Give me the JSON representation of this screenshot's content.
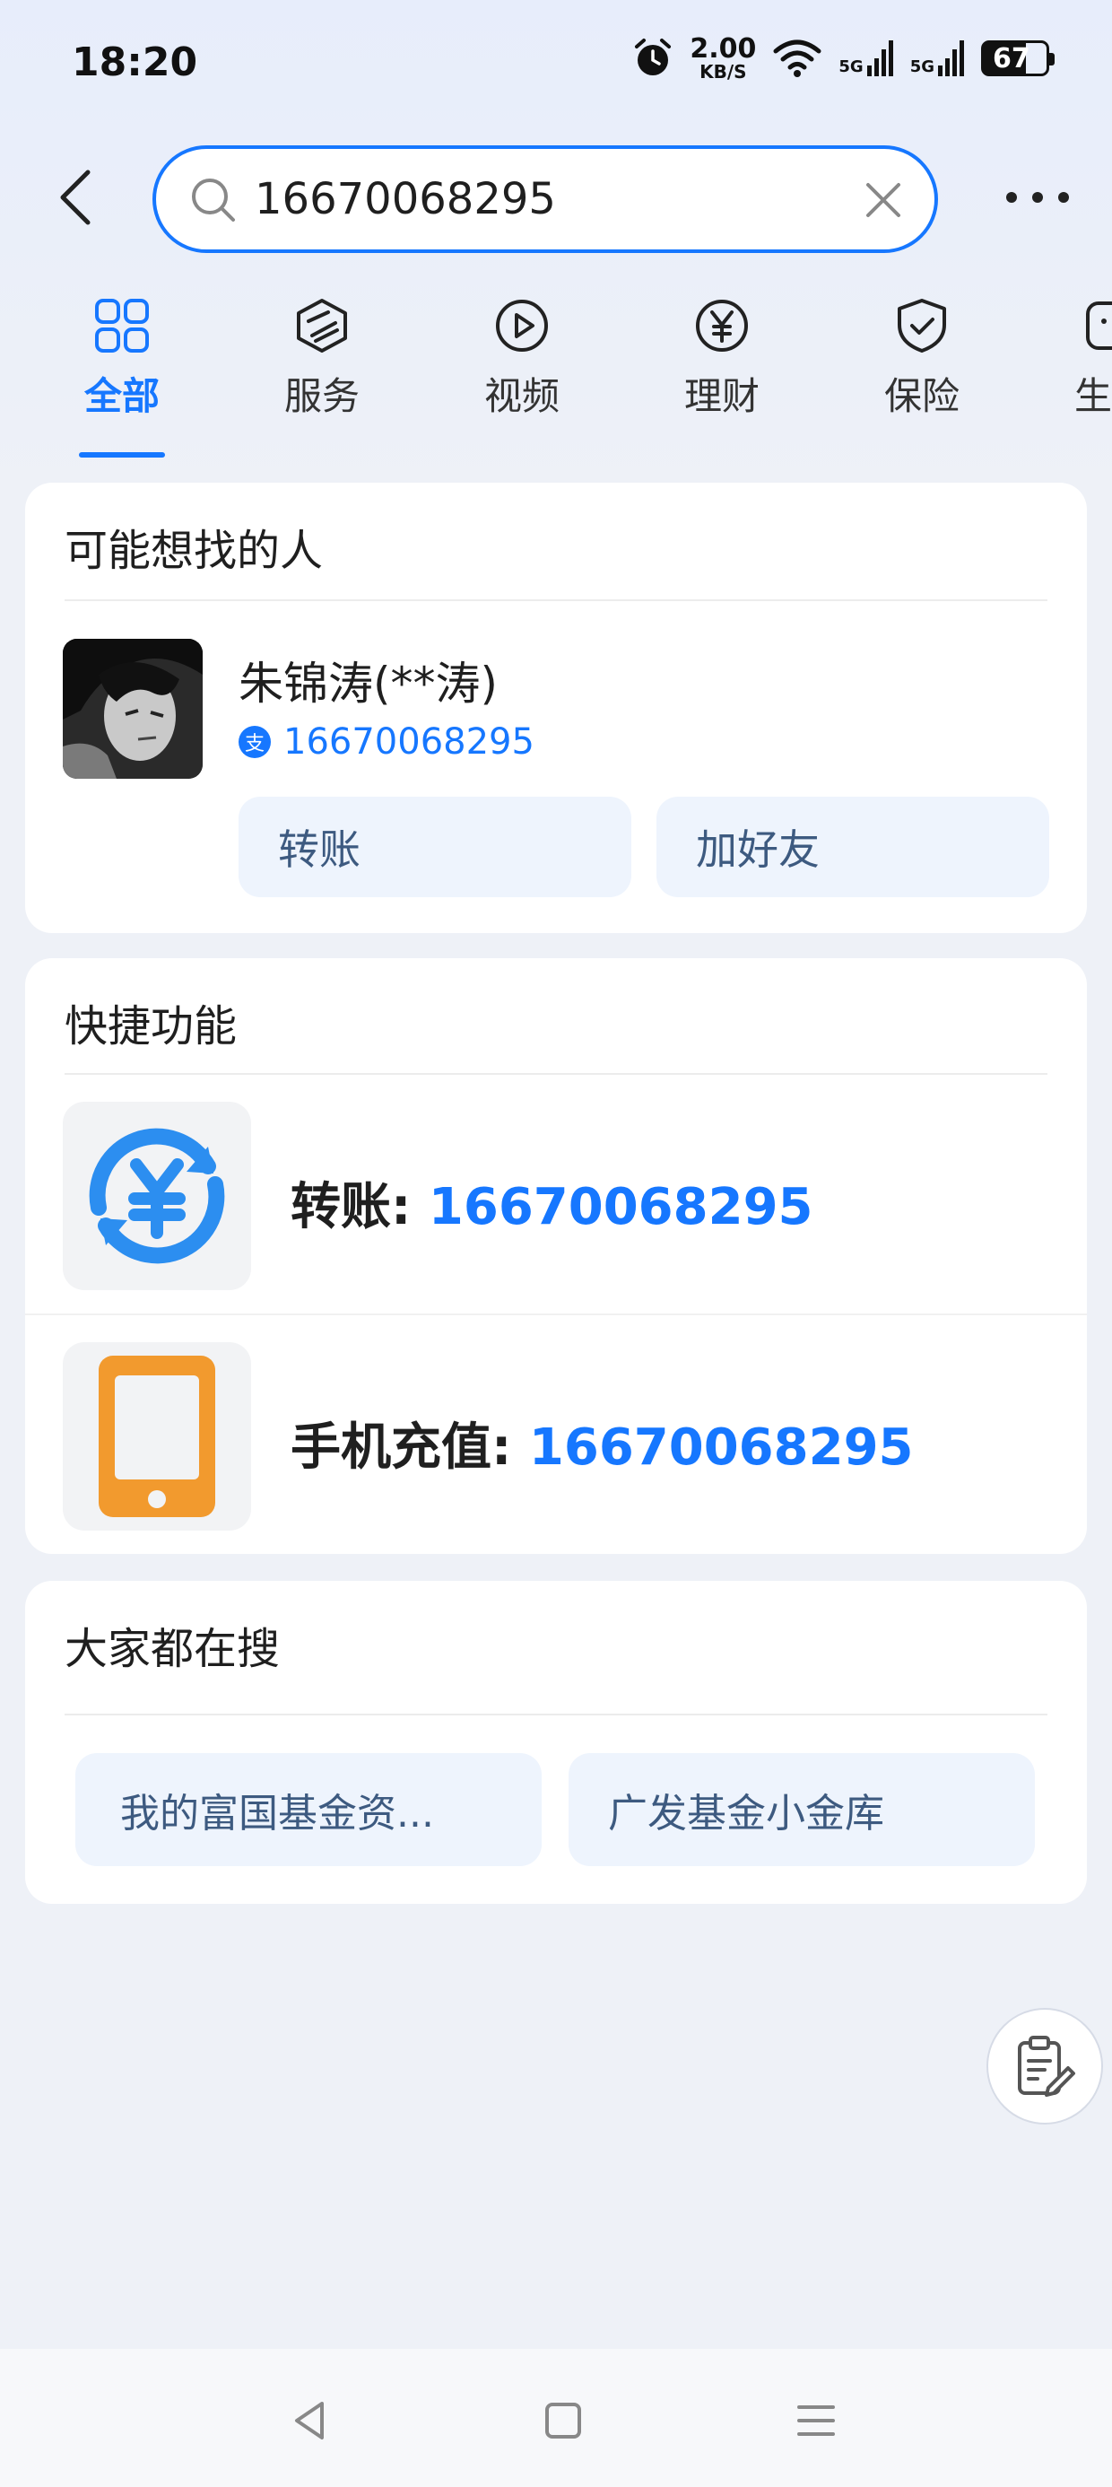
{
  "status_bar": {
    "time": "18:20",
    "net_speed_value": "2.00",
    "net_speed_unit": "KB/S",
    "signal_1": "5G",
    "signal_2": "5G",
    "battery": "67"
  },
  "search": {
    "value": "16670068295"
  },
  "tabs": [
    {
      "label": "全部",
      "icon": "grid-icon",
      "active": true
    },
    {
      "label": "服务",
      "icon": "cube-icon"
    },
    {
      "label": "视频",
      "icon": "play-icon"
    },
    {
      "label": "理财",
      "icon": "yen-icon"
    },
    {
      "label": "保险",
      "icon": "shield-icon"
    },
    {
      "label": "生活",
      "icon": "life-icon"
    }
  ],
  "people": {
    "title": "可能想找的人",
    "name": "朱锦涛(**涛)",
    "phone": "16670068295",
    "transfer_label": "转账",
    "add_friend_label": "加好友"
  },
  "quick": {
    "title": "快捷功能",
    "items": [
      {
        "label": "转账: ",
        "number": "16670068295",
        "icon": "transfer-yen-icon"
      },
      {
        "label": "手机充值: ",
        "number": "16670068295",
        "icon": "phone-topup-icon"
      }
    ]
  },
  "hot": {
    "title": "大家都在搜",
    "items": [
      "我的富国基金资...",
      "广发基金小金库"
    ]
  },
  "colors": {
    "accent": "#1677ff",
    "background": "#eef1f7",
    "chip_bg": "#eef4fd",
    "topup_orange": "#f29a2e"
  }
}
